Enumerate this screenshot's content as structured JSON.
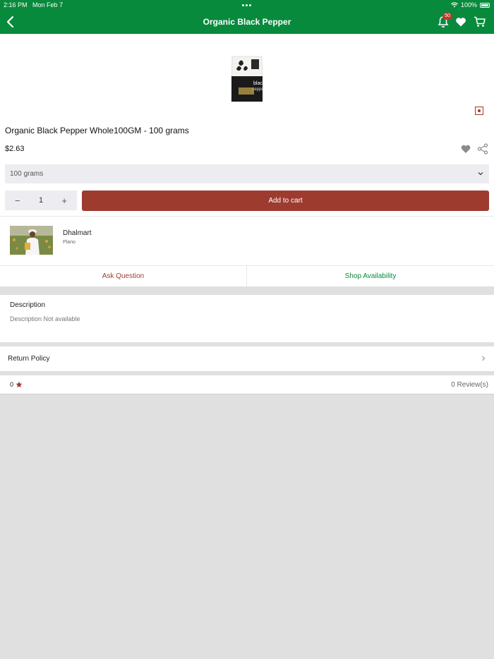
{
  "status_bar": {
    "time": "2:16 PM",
    "date": "Mon Feb 7",
    "battery": "100%"
  },
  "header": {
    "title": "Organic Black Pepper",
    "notification_count": "50"
  },
  "colors": {
    "brand_green": "#078a3c",
    "accent_red": "#9e3b2f"
  },
  "product": {
    "name": "Organic Black Pepper Whole100GM - 100 grams",
    "price": "$2.63",
    "variant": "100 grams",
    "quantity": "1",
    "add_to_cart": "Add to cart",
    "pack_text": "black pepper"
  },
  "store": {
    "name": "Dhalmart",
    "city": "Plano",
    "ask_question": "Ask Question",
    "shop_availability": "Shop Availability"
  },
  "description": {
    "title": "Description",
    "text": "Description Not available"
  },
  "return_policy": {
    "label": "Return Policy"
  },
  "rating": {
    "value": "0",
    "reviews": "0 Review(s)"
  },
  "icons": [
    "back-arrow-icon",
    "bell-icon",
    "heart-icon",
    "cart-icon",
    "share-icon",
    "chevron-down-icon",
    "chevron-right-icon",
    "star-icon",
    "wifi-icon",
    "battery-icon"
  ]
}
